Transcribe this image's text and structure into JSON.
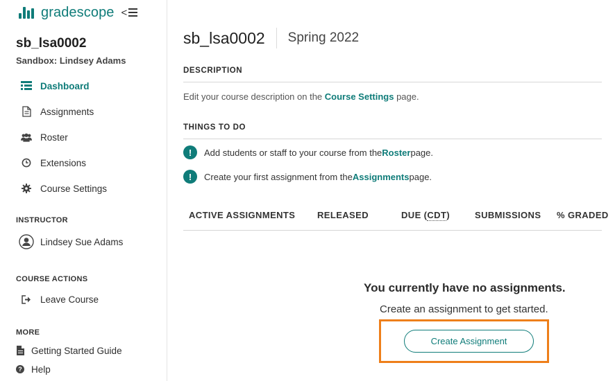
{
  "brand": {
    "logo_text": "gradescope",
    "collapse_glyph": "<",
    "accent": "#0f7c79"
  },
  "course": {
    "code": "sb_lsa0002",
    "subtitle": "Sandbox: Lindsey Adams",
    "term": "Spring 2022"
  },
  "sidebar": {
    "nav": [
      {
        "label": "Dashboard",
        "icon": "dashboard-icon",
        "active": true
      },
      {
        "label": "Assignments",
        "icon": "document-icon"
      },
      {
        "label": "Roster",
        "icon": "people-icon"
      },
      {
        "label": "Extensions",
        "icon": "clock-icon"
      },
      {
        "label": "Course Settings",
        "icon": "gear-icon"
      }
    ],
    "instructor_label": "INSTRUCTOR",
    "instructor_name": "Lindsey Sue Adams",
    "course_actions_label": "COURSE ACTIONS",
    "leave_course": "Leave Course",
    "more_label": "MORE",
    "more_items": [
      {
        "label": "Getting Started Guide",
        "icon": "file-icon"
      },
      {
        "label": "Help",
        "icon": "help-icon"
      }
    ]
  },
  "description": {
    "heading": "DESCRIPTION",
    "text_before": "Edit your course description on the ",
    "link": "Course Settings",
    "text_after": " page."
  },
  "things_to_do": {
    "heading": "THINGS TO DO",
    "items": [
      {
        "before": "Add students or staff to your course from the ",
        "link": "Roster",
        "after": " page."
      },
      {
        "before": "Create your first assignment from the ",
        "link": "Assignments",
        "after": " page."
      }
    ]
  },
  "table": {
    "headers": [
      "ACTIVE ASSIGNMENTS",
      "RELEASED",
      "DUE (",
      "CDT",
      ")",
      "SUBMISSIONS",
      "% GRADED"
    ]
  },
  "empty_state": {
    "title": "You currently have no assignments.",
    "subtitle": "Create an assignment to get started.",
    "button": "Create Assignment",
    "highlight_color": "#ee7f1a"
  }
}
